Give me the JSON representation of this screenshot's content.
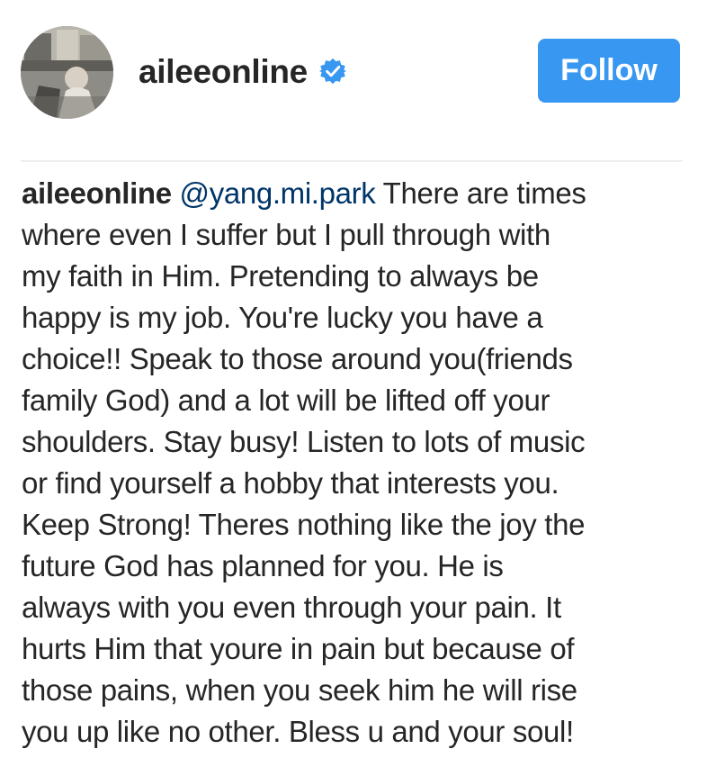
{
  "post": {
    "username": "aileeonline",
    "verified_icon": "verified-badge-icon",
    "follow_label": "Follow",
    "accent_color": "#3897f0"
  },
  "caption": {
    "author": "aileeonline",
    "mention": "@yang.mi.park",
    "first_line_rest": "There are times",
    "lines": [
      "where even I suffer but I pull through with",
      "my faith in Him. Pretending to always be",
      "happy is my job. You're lucky you have a",
      "choice!! Speak to those around you(friends",
      "family God) and a lot will be lifted off your",
      "shoulders. Stay busy! Listen to lots of music",
      "or find yourself a hobby that interests you.",
      "Keep Strong! Theres nothing like the joy the",
      "future God has planned for you. He is",
      "always with you even through your pain. It",
      "hurts Him that youre in pain but because of",
      "those pains, when you seek him he will rise",
      "you up like no other. Bless u and your soul!"
    ]
  }
}
